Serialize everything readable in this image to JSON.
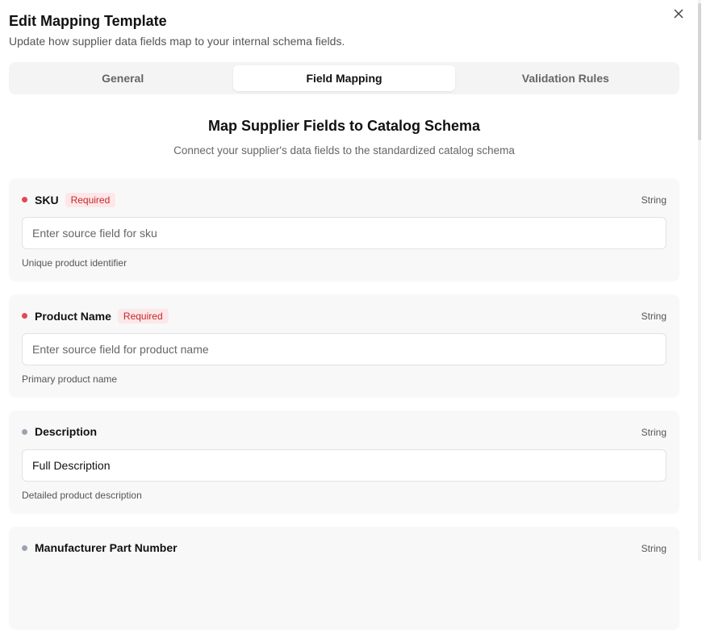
{
  "dialog": {
    "title": "Edit Mapping Template",
    "subtitle": "Update how supplier data fields map to your internal schema fields.",
    "close_icon": "close-icon"
  },
  "tabs": [
    {
      "label": "General",
      "active": false
    },
    {
      "label": "Field Mapping",
      "active": true
    },
    {
      "label": "Validation Rules",
      "active": false
    }
  ],
  "section": {
    "title": "Map Supplier Fields to Catalog Schema",
    "subtitle": "Connect your supplier's data fields to the standardized catalog schema"
  },
  "fields": [
    {
      "name": "SKU",
      "badge": "Required",
      "type": "String",
      "value": "",
      "placeholder": "Enter source field for sku",
      "help": "Unique product identifier"
    },
    {
      "name": "Product Name",
      "badge": "Required",
      "type": "String",
      "value": "",
      "placeholder": "Enter source field for product name",
      "help": "Primary product name"
    },
    {
      "name": "Description",
      "type": "String",
      "value": "Full Description",
      "placeholder": "",
      "help": "Detailed product description"
    },
    {
      "name": "Manufacturer Part Number",
      "type": "String"
    }
  ],
  "colors": {
    "required_dot": "#e5484d",
    "optional_dot": "#9ca3af",
    "badge_bg": "#fde7e8",
    "badge_text": "#c62828"
  }
}
